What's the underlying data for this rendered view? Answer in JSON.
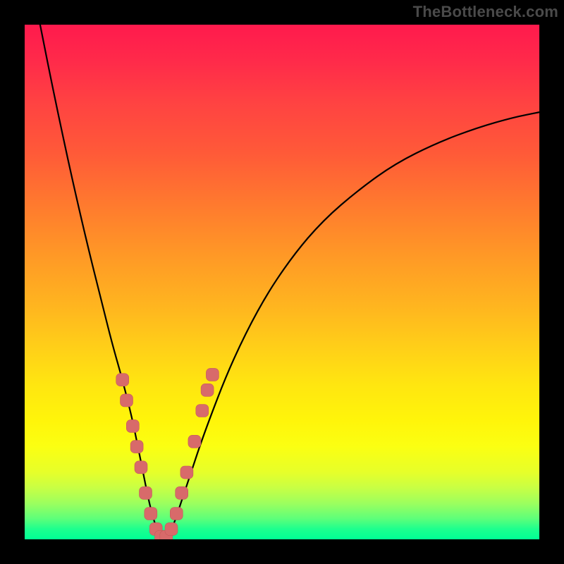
{
  "watermark": "TheBottleneck.com",
  "colors": {
    "background": "#000000",
    "curve": "#000000",
    "marker_fill": "#d86a6a",
    "marker_stroke": "#c45a5a",
    "gradient_top": "#ff1a4d",
    "gradient_bottom": "#00ff95"
  },
  "chart_data": {
    "type": "line",
    "title": "",
    "xlabel": "",
    "ylabel": "",
    "xlim": [
      0,
      100
    ],
    "ylim": [
      0,
      100
    ],
    "grid": false,
    "legend": false,
    "notes": "V-shaped bottleneck curve over a vertical heat gradient; value is bottleneck percentage (lower=better/green). Markers are sample data points along the curve. x and y are normalized 0-100 within the plot area.",
    "series": [
      {
        "name": "bottleneck-curve",
        "x": [
          3,
          6,
          9,
          12,
          15,
          17,
          19,
          21,
          22,
          23,
          24,
          25,
          26,
          27,
          28,
          29,
          30,
          32,
          35,
          40,
          46,
          52,
          58,
          65,
          72,
          80,
          88,
          95,
          100
        ],
        "y": [
          100,
          85,
          71,
          58,
          46,
          38,
          31,
          23,
          18,
          13,
          8,
          4,
          1,
          0,
          1,
          3,
          6,
          12,
          21,
          34,
          46,
          55,
          62,
          68,
          73,
          77,
          80,
          82,
          83
        ]
      }
    ],
    "markers": [
      {
        "x": 19.0,
        "y": 31.0
      },
      {
        "x": 19.8,
        "y": 27.0
      },
      {
        "x": 21.0,
        "y": 22.0
      },
      {
        "x": 21.8,
        "y": 18.0
      },
      {
        "x": 22.6,
        "y": 14.0
      },
      {
        "x": 23.5,
        "y": 9.0
      },
      {
        "x": 24.5,
        "y": 5.0
      },
      {
        "x": 25.5,
        "y": 2.0
      },
      {
        "x": 26.5,
        "y": 0.5
      },
      {
        "x": 27.5,
        "y": 0.5
      },
      {
        "x": 28.5,
        "y": 2.0
      },
      {
        "x": 29.5,
        "y": 5.0
      },
      {
        "x": 30.5,
        "y": 9.0
      },
      {
        "x": 31.5,
        "y": 13.0
      },
      {
        "x": 33.0,
        "y": 19.0
      },
      {
        "x": 34.5,
        "y": 25.0
      },
      {
        "x": 35.5,
        "y": 29.0
      },
      {
        "x": 36.5,
        "y": 32.0
      }
    ]
  }
}
